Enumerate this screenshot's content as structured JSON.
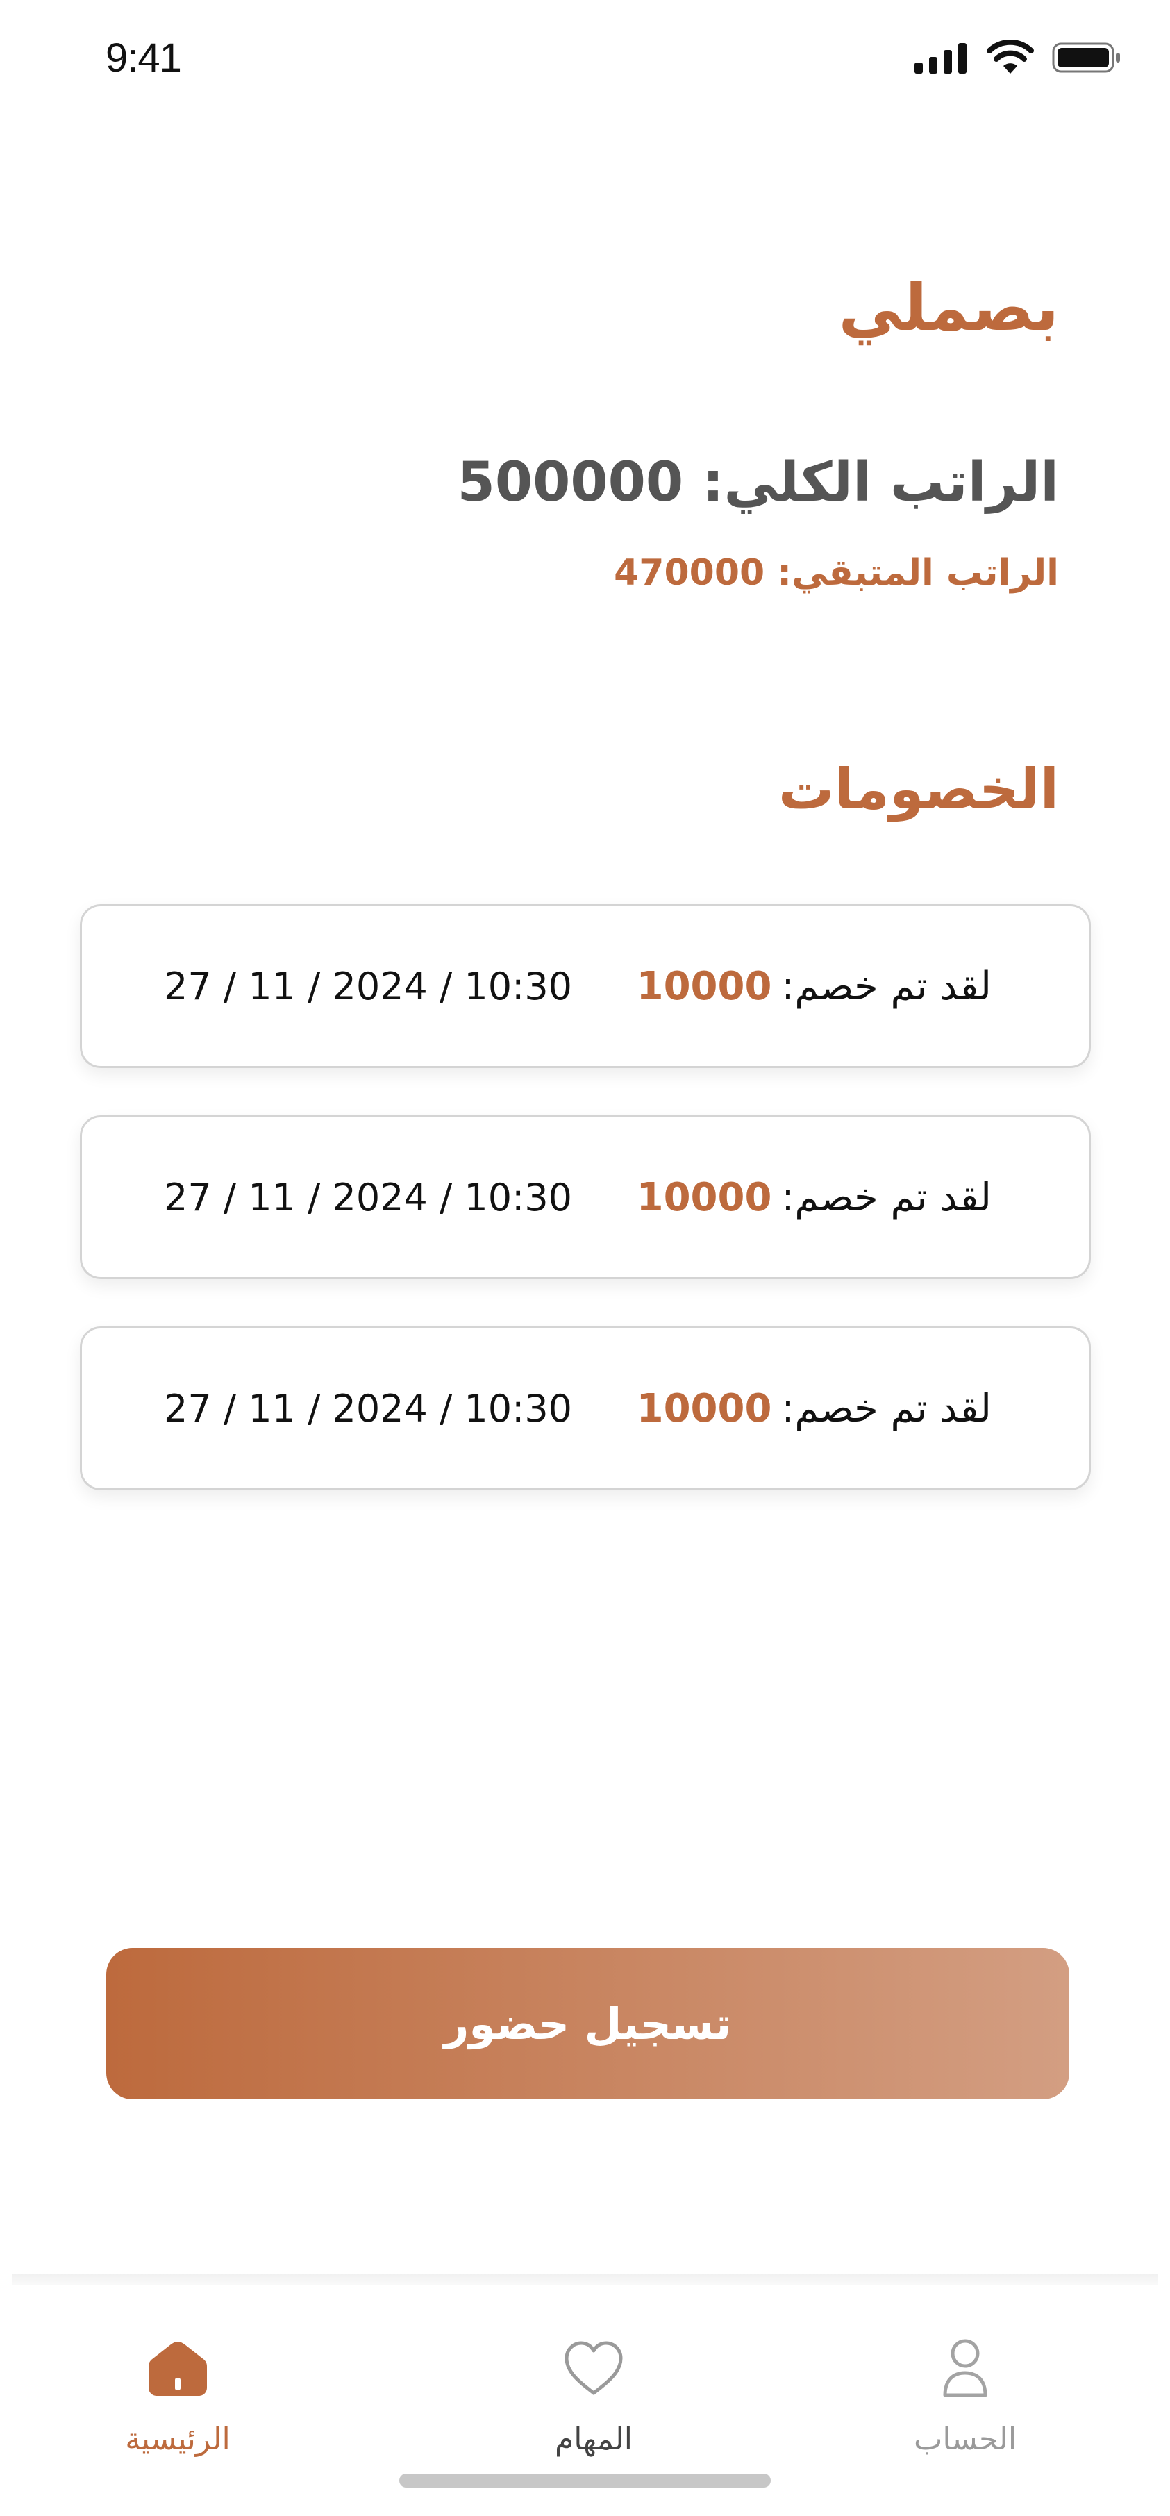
{
  "status_bar": {
    "time": "9:41"
  },
  "header": {
    "brand": "بصملي",
    "total_salary": "الراتب الكلي: 500000",
    "remaining_salary": "الراتب المتبقي: 470000"
  },
  "deductions": {
    "title": "الخصومات",
    "items": [
      {
        "label": "لقد تم خصم:",
        "amount": "10000",
        "date": "27 / 11 / 2024 / 10:30"
      },
      {
        "label": "لقد تم خصم:",
        "amount": "10000",
        "date": "27 / 11 / 2024 / 10:30"
      },
      {
        "label": "لقد تم خصم:",
        "amount": "10000",
        "date": "27 / 11 / 2024 / 10:30"
      }
    ]
  },
  "actions": {
    "attendance_button": "تسجيل حضور"
  },
  "tab_bar": {
    "home": {
      "label": "الرئيسية",
      "icon": "home-icon",
      "active": true
    },
    "tasks": {
      "label": "المهام",
      "icon": "heart-icon"
    },
    "account": {
      "label": "الحساب",
      "icon": "user-icon"
    }
  },
  "colors": {
    "accent": "#BD6A3D",
    "accent_light": "#D39E82",
    "text": "#111111",
    "muted": "#555555"
  }
}
